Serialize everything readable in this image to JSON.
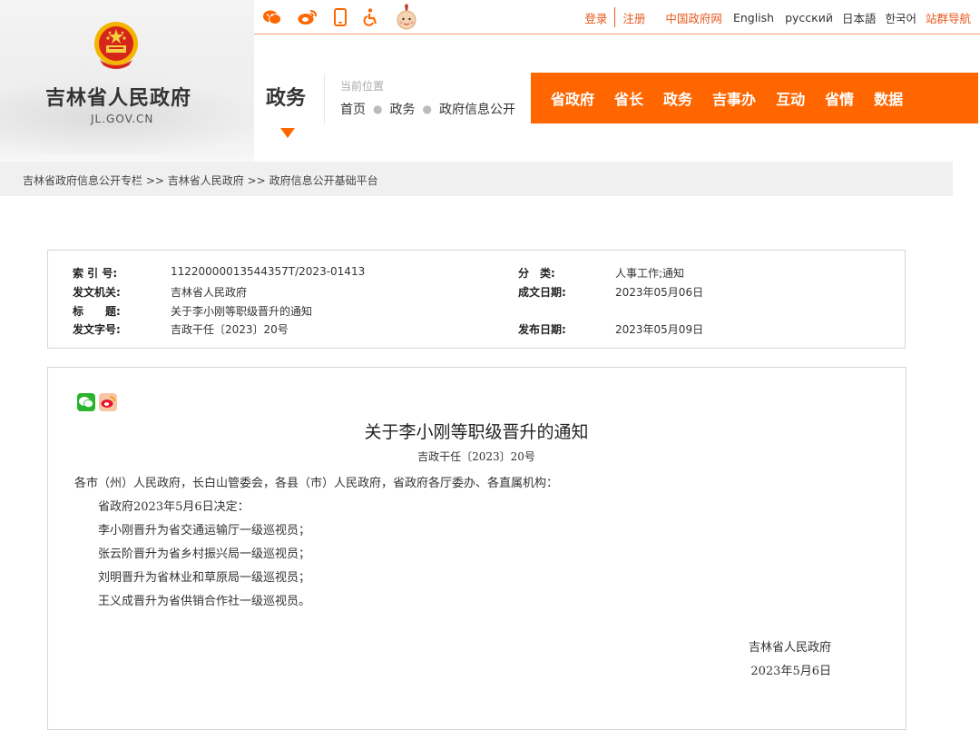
{
  "header": {
    "site_name": "吉林省人民政府",
    "site_domain": "JL.GOV.CN",
    "section_title": "政务",
    "location_label": "当前位置",
    "location_path": [
      "首页",
      "政务",
      "政府信息公开"
    ],
    "top_icons": [
      "wechat-icon",
      "weibo-icon",
      "mobile-icon",
      "accessibility-icon",
      "mascot-icon"
    ],
    "top_links": {
      "login": "登录",
      "register": "注册",
      "gov_portal": "中国政府网",
      "english": "English",
      "russian": "русский",
      "japanese": "日本語",
      "korean": "한국어",
      "sitemap": "站群导航"
    },
    "main_nav": [
      "省政府",
      "省长",
      "政务",
      "吉事办",
      "互动",
      "省情",
      "数据"
    ]
  },
  "breadcrumb": {
    "items": [
      "吉林省政府信息公开专栏",
      "吉林省人民政府",
      "政府信息公开基础平台"
    ],
    "separator": ">>"
  },
  "meta": {
    "index_label": "索 引 号:",
    "index_value": "11220000013544357T/2023-01413",
    "category_label": "分　类:",
    "category_value": "人事工作;通知",
    "issuer_label": "发文机关:",
    "issuer_value": "吉林省人民政府",
    "created_label": "成文日期:",
    "created_value": "2023年05月06日",
    "title_label": "标　　题:",
    "title_value": "关于李小刚等职级晋升的通知",
    "docno_label": "发文字号:",
    "docno_value": "吉政干任〔2023〕20号",
    "published_label": "发布日期:",
    "published_value": "2023年05月09日"
  },
  "document": {
    "share_icons": [
      "wechat-share-icon",
      "weibo-share-icon"
    ],
    "title": "关于李小刚等职级晋升的通知",
    "number": "吉政干任〔2023〕20号",
    "addressee": "各市（州）人民政府，长白山管委会，各县（市）人民政府，省政府各厅委办、各直属机构：",
    "paragraphs": [
      "省政府2023年5月6日决定：",
      "李小刚晋升为省交通运输厅一级巡视员；",
      "张云阶晋升为省乡村振兴局一级巡视员；",
      "刘明晋升为省林业和草原局一级巡视员；",
      "王义成晋升为省供销合作社一级巡视员。"
    ],
    "signature": "吉林省人民政府",
    "date": "2023年5月6日"
  },
  "colors": {
    "accent": "#ff6600",
    "link": "#e8581d"
  }
}
